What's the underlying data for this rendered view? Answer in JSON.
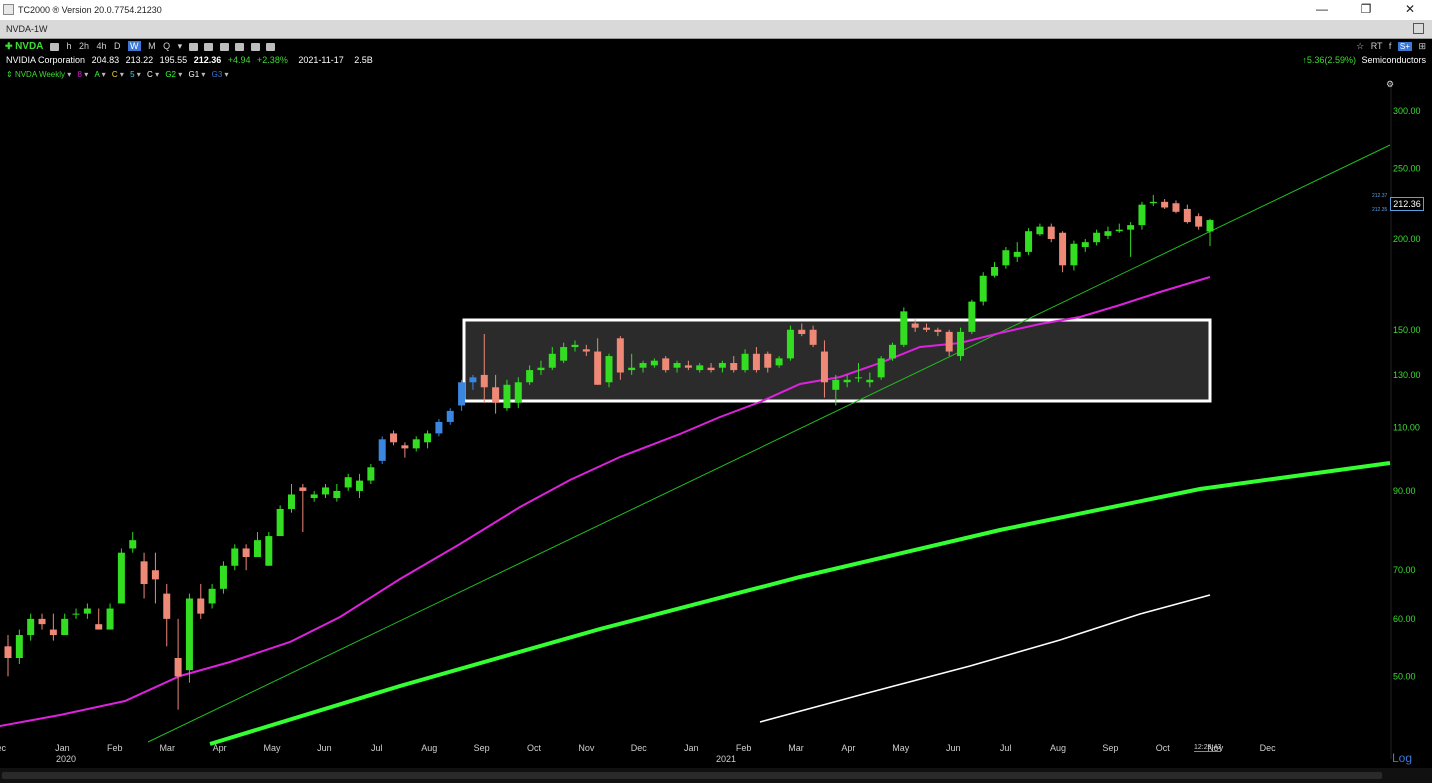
{
  "window": {
    "title": "TC2000 ® Version 20.0.7754.21230",
    "tab_title": "NVDA-1W",
    "minimize": "—",
    "restore": "❐",
    "close": "✕"
  },
  "toolbar": {
    "symbol": "NVDA",
    "timeframes": [
      "h",
      "2h",
      "4h",
      "D",
      "W",
      "M",
      "Q"
    ],
    "active_timeframe": "W"
  },
  "quote": {
    "company": "NVIDIA Corporation",
    "open": "204.83",
    "high": "213.22",
    "low": "195.55",
    "last": "212.36",
    "change": "+4.94",
    "change_pct": "+2.38%",
    "date": "2021-11-17",
    "volume": "2.5B",
    "sector_change": "5.36(2.59%)",
    "sector": "Semiconductors"
  },
  "indicators": {
    "chart_label": "NVDA Weekly",
    "items": [
      "8",
      "A",
      "C",
      "5",
      "C",
      "G2",
      "G1",
      "G3"
    ]
  },
  "right_icons": [
    "☆",
    "RT",
    "f",
    "S+",
    "⊞"
  ],
  "current_price_tag": "212.36",
  "mini_tags": [
    "212.37",
    "212.35"
  ],
  "chart_time": "12:28:43",
  "scale_mode": "Log",
  "colors": {
    "background": "#000000",
    "up": "#33dd22",
    "down": "#ee8877",
    "blue_candle": "#3a86e0",
    "ma_short": "#dd22dd",
    "ma_long": "#33ff33",
    "ma_200": "#ffffff",
    "trendline": "#22bb22",
    "axis_text": "#3ddc32"
  },
  "chart_data": {
    "type": "candlestick",
    "title": "NVDA Weekly",
    "scale": "log",
    "ylim": [
      40,
      330
    ],
    "y_ticks": [
      "300.00",
      "250.00",
      "200.00",
      "150.00",
      "130.00",
      "110.00",
      "90.00",
      "70.00",
      "60.00",
      "50.00"
    ],
    "y_tick_values": [
      300,
      250,
      200,
      150,
      130,
      110,
      90,
      70,
      60,
      50
    ],
    "x_ticks": [
      "Dec",
      "Jan",
      "Feb",
      "Mar",
      "Apr",
      "May",
      "Jun",
      "Jul",
      "Aug",
      "Sep",
      "Oct",
      "Nov",
      "Dec",
      "Jan",
      "Feb",
      "Mar",
      "Apr",
      "May",
      "Jun",
      "Jul",
      "Aug",
      "Sep",
      "Oct",
      "Nov",
      "Dec"
    ],
    "year_labels": [
      "2020",
      "2021"
    ],
    "candles": [
      {
        "o": 55,
        "h": 57,
        "l": 50,
        "c": 53
      },
      {
        "o": 53,
        "h": 58,
        "l": 52,
        "c": 57
      },
      {
        "o": 57,
        "h": 61,
        "l": 56,
        "c": 60
      },
      {
        "o": 60,
        "h": 61,
        "l": 58,
        "c": 59
      },
      {
        "o": 58,
        "h": 61,
        "l": 56,
        "c": 57
      },
      {
        "o": 57,
        "h": 61,
        "l": 57,
        "c": 60
      },
      {
        "o": 61,
        "h": 62,
        "l": 60,
        "c": 61
      },
      {
        "o": 61,
        "h": 63,
        "l": 60,
        "c": 62
      },
      {
        "o": 59,
        "h": 62,
        "l": 58,
        "c": 58
      },
      {
        "o": 58,
        "h": 63,
        "l": 58,
        "c": 62
      },
      {
        "o": 63,
        "h": 75,
        "l": 63,
        "c": 74
      },
      {
        "o": 75,
        "h": 79,
        "l": 74,
        "c": 77
      },
      {
        "o": 72,
        "h": 74,
        "l": 64,
        "c": 67
      },
      {
        "o": 70,
        "h": 74,
        "l": 63,
        "c": 68
      },
      {
        "o": 65,
        "h": 67,
        "l": 55,
        "c": 60
      },
      {
        "o": 53,
        "h": 60,
        "l": 45,
        "c": 50
      },
      {
        "o": 51,
        "h": 65,
        "l": 49,
        "c": 64
      },
      {
        "o": 64,
        "h": 67,
        "l": 60,
        "c": 61
      },
      {
        "o": 63,
        "h": 67,
        "l": 62,
        "c": 66
      },
      {
        "o": 66,
        "h": 72,
        "l": 65,
        "c": 71
      },
      {
        "o": 71,
        "h": 76,
        "l": 70,
        "c": 75
      },
      {
        "o": 75,
        "h": 76,
        "l": 70,
        "c": 73
      },
      {
        "o": 73,
        "h": 79,
        "l": 73,
        "c": 77
      },
      {
        "o": 71,
        "h": 79,
        "l": 71,
        "c": 78
      },
      {
        "o": 78,
        "h": 86,
        "l": 78,
        "c": 85
      },
      {
        "o": 85,
        "h": 92,
        "l": 84,
        "c": 89
      },
      {
        "o": 91,
        "h": 92,
        "l": 79,
        "c": 90
      },
      {
        "o": 88,
        "h": 90,
        "l": 87,
        "c": 89
      },
      {
        "o": 89,
        "h": 92,
        "l": 88,
        "c": 91
      },
      {
        "o": 88,
        "h": 92,
        "l": 87,
        "c": 90
      },
      {
        "o": 91,
        "h": 95,
        "l": 90,
        "c": 94
      },
      {
        "o": 90,
        "h": 95,
        "l": 88,
        "c": 93
      },
      {
        "o": 93,
        "h": 98,
        "l": 92,
        "c": 97
      },
      {
        "o": 99,
        "h": 107,
        "l": 98,
        "c": 106,
        "blue": true
      },
      {
        "o": 108,
        "h": 109,
        "l": 104,
        "c": 105
      },
      {
        "o": 104,
        "h": 105,
        "l": 100,
        "c": 103
      },
      {
        "o": 103,
        "h": 107,
        "l": 102,
        "c": 106
      },
      {
        "o": 105,
        "h": 109,
        "l": 103,
        "c": 108
      },
      {
        "o": 108,
        "h": 113,
        "l": 107,
        "c": 112,
        "blue": true
      },
      {
        "o": 112,
        "h": 117,
        "l": 111,
        "c": 116,
        "blue": true
      },
      {
        "o": 118,
        "h": 128,
        "l": 116,
        "c": 127,
        "blue": true
      },
      {
        "o": 127,
        "h": 130,
        "l": 124,
        "c": 129,
        "blue": true
      },
      {
        "o": 130,
        "h": 148,
        "l": 119,
        "c": 125
      },
      {
        "o": 125,
        "h": 130,
        "l": 115,
        "c": 119
      },
      {
        "o": 117,
        "h": 128,
        "l": 116,
        "c": 126
      },
      {
        "o": 119,
        "h": 129,
        "l": 117,
        "c": 127
      },
      {
        "o": 127,
        "h": 134,
        "l": 126,
        "c": 132
      },
      {
        "o": 132,
        "h": 136,
        "l": 130,
        "c": 133
      },
      {
        "o": 133,
        "h": 142,
        "l": 132,
        "c": 139
      },
      {
        "o": 136,
        "h": 144,
        "l": 135,
        "c": 142
      },
      {
        "o": 142,
        "h": 145,
        "l": 140,
        "c": 143
      },
      {
        "o": 141,
        "h": 143,
        "l": 138,
        "c": 140
      },
      {
        "o": 140,
        "h": 146,
        "l": 126,
        "c": 126
      },
      {
        "o": 127,
        "h": 139,
        "l": 125,
        "c": 138
      },
      {
        "o": 146,
        "h": 147,
        "l": 128,
        "c": 131
      },
      {
        "o": 132,
        "h": 139,
        "l": 130,
        "c": 133
      },
      {
        "o": 133,
        "h": 136,
        "l": 131,
        "c": 135
      },
      {
        "o": 134,
        "h": 137,
        "l": 133,
        "c": 136
      },
      {
        "o": 137,
        "h": 138,
        "l": 131,
        "c": 132
      },
      {
        "o": 133,
        "h": 136,
        "l": 131,
        "c": 135
      },
      {
        "o": 134,
        "h": 136,
        "l": 132,
        "c": 133
      },
      {
        "o": 132,
        "h": 135,
        "l": 131,
        "c": 134
      },
      {
        "o": 133,
        "h": 135,
        "l": 131,
        "c": 132
      },
      {
        "o": 133,
        "h": 136,
        "l": 131,
        "c": 135
      },
      {
        "o": 135,
        "h": 138,
        "l": 131,
        "c": 132
      },
      {
        "o": 132,
        "h": 141,
        "l": 131,
        "c": 139
      },
      {
        "o": 139,
        "h": 142,
        "l": 131,
        "c": 132
      },
      {
        "o": 139,
        "h": 140,
        "l": 131,
        "c": 133
      },
      {
        "o": 134,
        "h": 138,
        "l": 133,
        "c": 137
      },
      {
        "o": 137,
        "h": 152,
        "l": 136,
        "c": 150
      },
      {
        "o": 150,
        "h": 153,
        "l": 147,
        "c": 148
      },
      {
        "o": 150,
        "h": 152,
        "l": 142,
        "c": 143
      },
      {
        "o": 140,
        "h": 145,
        "l": 121,
        "c": 127
      },
      {
        "o": 124,
        "h": 130,
        "l": 118,
        "c": 128
      },
      {
        "o": 127,
        "h": 130,
        "l": 125,
        "c": 128
      },
      {
        "o": 129,
        "h": 135,
        "l": 127,
        "c": 129
      },
      {
        "o": 127,
        "h": 131,
        "l": 125,
        "c": 128
      },
      {
        "o": 129,
        "h": 138,
        "l": 128,
        "c": 137
      },
      {
        "o": 137,
        "h": 144,
        "l": 136,
        "c": 143
      },
      {
        "o": 143,
        "h": 161,
        "l": 142,
        "c": 159
      },
      {
        "o": 153,
        "h": 155,
        "l": 149,
        "c": 151
      },
      {
        "o": 151,
        "h": 153,
        "l": 149,
        "c": 150
      },
      {
        "o": 150,
        "h": 151,
        "l": 147,
        "c": 149
      },
      {
        "o": 149,
        "h": 150,
        "l": 138,
        "c": 140
      },
      {
        "o": 138,
        "h": 151,
        "l": 136,
        "c": 149
      },
      {
        "o": 149,
        "h": 165,
        "l": 148,
        "c": 164
      },
      {
        "o": 164,
        "h": 180,
        "l": 162,
        "c": 178
      },
      {
        "o": 178,
        "h": 186,
        "l": 177,
        "c": 183
      },
      {
        "o": 184,
        "h": 195,
        "l": 182,
        "c": 193
      },
      {
        "o": 189,
        "h": 198,
        "l": 186,
        "c": 192
      },
      {
        "o": 192,
        "h": 207,
        "l": 190,
        "c": 205
      },
      {
        "o": 203,
        "h": 210,
        "l": 202,
        "c": 208
      },
      {
        "o": 208,
        "h": 210,
        "l": 198,
        "c": 200
      },
      {
        "o": 204,
        "h": 205,
        "l": 180,
        "c": 184
      },
      {
        "o": 184,
        "h": 199,
        "l": 181,
        "c": 197
      },
      {
        "o": 195,
        "h": 200,
        "l": 192,
        "c": 198
      },
      {
        "o": 198,
        "h": 206,
        "l": 196,
        "c": 204
      },
      {
        "o": 202,
        "h": 208,
        "l": 200,
        "c": 205
      },
      {
        "o": 205,
        "h": 210,
        "l": 204,
        "c": 206
      },
      {
        "o": 206,
        "h": 211,
        "l": 189,
        "c": 209
      },
      {
        "o": 209,
        "h": 225,
        "l": 206,
        "c": 223
      },
      {
        "o": 224,
        "h": 230,
        "l": 222,
        "c": 225
      },
      {
        "o": 225,
        "h": 227,
        "l": 220,
        "c": 221
      },
      {
        "o": 224,
        "h": 226,
        "l": 217,
        "c": 218
      },
      {
        "o": 220,
        "h": 223,
        "l": 210,
        "c": 211
      },
      {
        "o": 215,
        "h": 217,
        "l": 206,
        "c": 208
      },
      {
        "o": 204.83,
        "h": 213.22,
        "l": 195.55,
        "c": 212.36
      }
    ],
    "series": [
      {
        "name": "MA short",
        "values": [
          55,
          56,
          57,
          58,
          59,
          60,
          62,
          64,
          66,
          69,
          72,
          76,
          81,
          87,
          93,
          98,
          104,
          110,
          115,
          120,
          124,
          128,
          131,
          133,
          135,
          140,
          145,
          150,
          157,
          163,
          168,
          172
        ]
      },
      {
        "name": "MA long",
        "values": [
          40,
          43,
          46,
          49,
          52,
          55,
          59,
          63,
          67,
          71,
          75,
          79,
          83,
          87,
          91,
          95,
          99
        ]
      },
      {
        "name": "MA 200",
        "values": [
          40,
          42,
          44,
          46,
          48,
          50,
          52,
          54,
          56,
          58,
          60
        ]
      }
    ],
    "annotations": [
      {
        "type": "consolidation-box",
        "from_price": 118,
        "to_price": 150
      },
      {
        "type": "trendline",
        "from_price": 40,
        "to_price": 250
      }
    ]
  }
}
